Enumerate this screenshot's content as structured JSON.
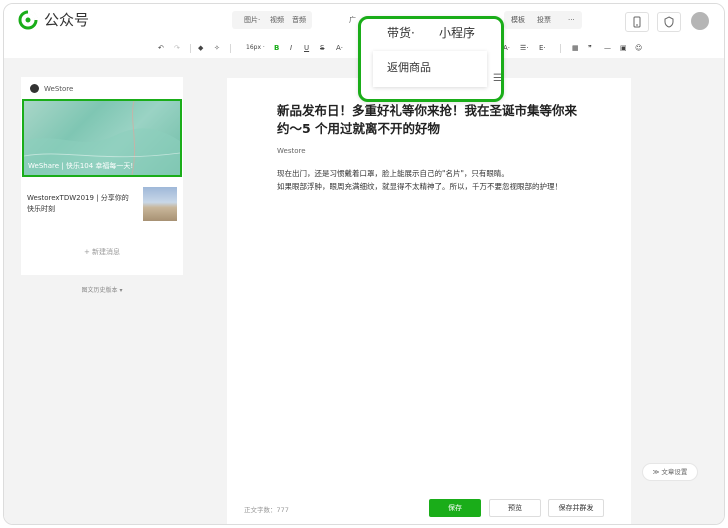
{
  "app": {
    "title": "公众号"
  },
  "topmenu": {
    "items": [
      "图片·",
      "视频",
      "音频",
      "广",
      "模板",
      "投票",
      "···"
    ]
  },
  "toolbar": {
    "undo": "↶",
    "redo": "↷",
    "format": "◆",
    "clear": "✧",
    "font_size": "16px ·",
    "bold": "B",
    "italic": "I",
    "underline": "U",
    "strike": "S",
    "color": "A·",
    "align": "A·",
    "list": "☰·",
    "indent": "E·",
    "table": "▦",
    "quote": "❞",
    "hr": "—",
    "image": "▣",
    "emoji": "☺"
  },
  "sidebar": {
    "account_name": "WeStore",
    "cover_caption": "WeShare | 快乐104 幸福每一天!",
    "item2_title": "WestorexTDW2019 | 分享你的快乐时刻",
    "new_message": "+ 新建消息",
    "history": "图文历史版本 ▾"
  },
  "article": {
    "title": "新品发布日！多重好礼等你来抢！我在圣诞市集等你来约～5 个用过就离不开的好物",
    "author": "Westore",
    "body_line1": "现在出门，还是习惯戴着口罩，脸上能展示自己的\"名片\"，只有眼睛。",
    "body_line2": "如果眼部浮肿，眼周充满细纹，就显得不太精神了。所以，千万不要忽视眼部的护理！"
  },
  "footer": {
    "word_count": "正文字数：777",
    "save": "保存",
    "preview": "预览",
    "publish": "保存并群发",
    "article_settings": "≫ 文章设置"
  },
  "popup": {
    "tab_sales": "带货·",
    "tab_miniprogram": "小程序",
    "dropdown_item": "返佣商品",
    "side_icon": "☰"
  },
  "colors": {
    "accent": "#1aad19"
  }
}
